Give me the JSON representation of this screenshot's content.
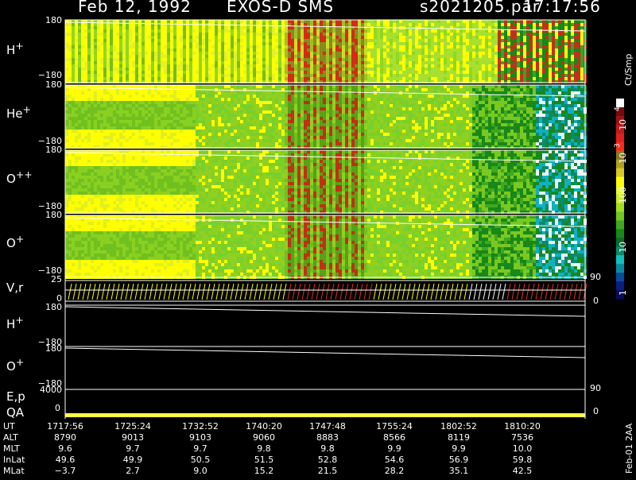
{
  "header": {
    "date": "Feb 12, 1992",
    "mission": "EXOS-D SMS",
    "file": "s2021205.par",
    "time": "17:17:56"
  },
  "panels": [
    {
      "label": "H",
      "sup": "+",
      "top_tick": "180",
      "bottom_tick": "−180"
    },
    {
      "label": "He",
      "sup": "+",
      "top_tick": "180",
      "bottom_tick": "−180"
    },
    {
      "label": "O",
      "sup": "++",
      "top_tick": "180",
      "bottom_tick": "−180"
    },
    {
      "label": "O",
      "sup": "+",
      "top_tick": "180",
      "bottom_tick": "−180"
    }
  ],
  "vr_panel": {
    "label": "V,r",
    "top_tick": "25",
    "bottom_tick": "0",
    "right_top": "90",
    "right_bottom": "0"
  },
  "line_panels": [
    {
      "label": "H",
      "sup": "+",
      "top_tick": "180",
      "bottom_tick": "−180"
    },
    {
      "label": "O",
      "sup": "+",
      "top_tick": "180",
      "bottom_tick": "−180"
    }
  ],
  "ep_panel": {
    "label": "E,p",
    "tick": "4000",
    "right_tick": "90"
  },
  "qa_panel": {
    "label": "QA",
    "tick": "0",
    "right_tick": "0"
  },
  "colorbar": {
    "unit": "Ct/Smp",
    "labels": [
      "10",
      "4",
      "10",
      "3",
      "100",
      "10",
      "1"
    ],
    "colors": [
      "#ffffff",
      "#7a0a0a",
      "#a01212",
      "#c21a1a",
      "#e02020",
      "#ff2a1a",
      "#8a7a20",
      "#b0a020",
      "#d8c820",
      "#ffff00",
      "#e8ff30",
      "#c8f020",
      "#a0e020",
      "#70c820",
      "#40a820",
      "#188818",
      "#0a6a30",
      "#0a8a6a",
      "#10c0c0",
      "#0a8aa0",
      "#0a4aa0",
      "#0a2080",
      "#0a0a60"
    ]
  },
  "footer_note": "Feb-01 2AA",
  "time_axis": {
    "rows": [
      {
        "label": "UT",
        "values": [
          "1717:56",
          "1725:24",
          "1732:52",
          "1740:20",
          "1747:48",
          "1755:24",
          "1802:52",
          "1810:20"
        ]
      },
      {
        "label": "ALT",
        "values": [
          "8790",
          "9013",
          "9103",
          "9060",
          "8883",
          "8566",
          "8119",
          "7536"
        ]
      },
      {
        "label": "MLT",
        "values": [
          "9.6",
          "9.7",
          "9.7",
          "9.8",
          "9.8",
          "9.9",
          "9.9",
          "10.0"
        ]
      },
      {
        "label": "InLat",
        "values": [
          "49.6",
          "49.9",
          "50.5",
          "51.5",
          "52.8",
          "54.6",
          "56.9",
          "59.8"
        ]
      },
      {
        "label": "MLat",
        "values": [
          "−3.7",
          "2.7",
          "9.0",
          "15.2",
          "21.5",
          "28.2",
          "35.1",
          "42.5"
        ]
      }
    ]
  },
  "chart_data": {
    "type": "heatmap",
    "title": "Feb 12, 1992   EXOS-D SMS",
    "x_time_labels": [
      "1717:56",
      "1725:24",
      "1732:52",
      "1740:20",
      "1747:48",
      "1755:24",
      "1802:52",
      "1810:20"
    ],
    "panels": [
      "H+",
      "He+",
      "O++",
      "O+"
    ],
    "ylim": [
      -180,
      180
    ],
    "color_scale": {
      "unit": "Ct/Smp",
      "scale": "log",
      "range": [
        1,
        10000
      ]
    }
  }
}
